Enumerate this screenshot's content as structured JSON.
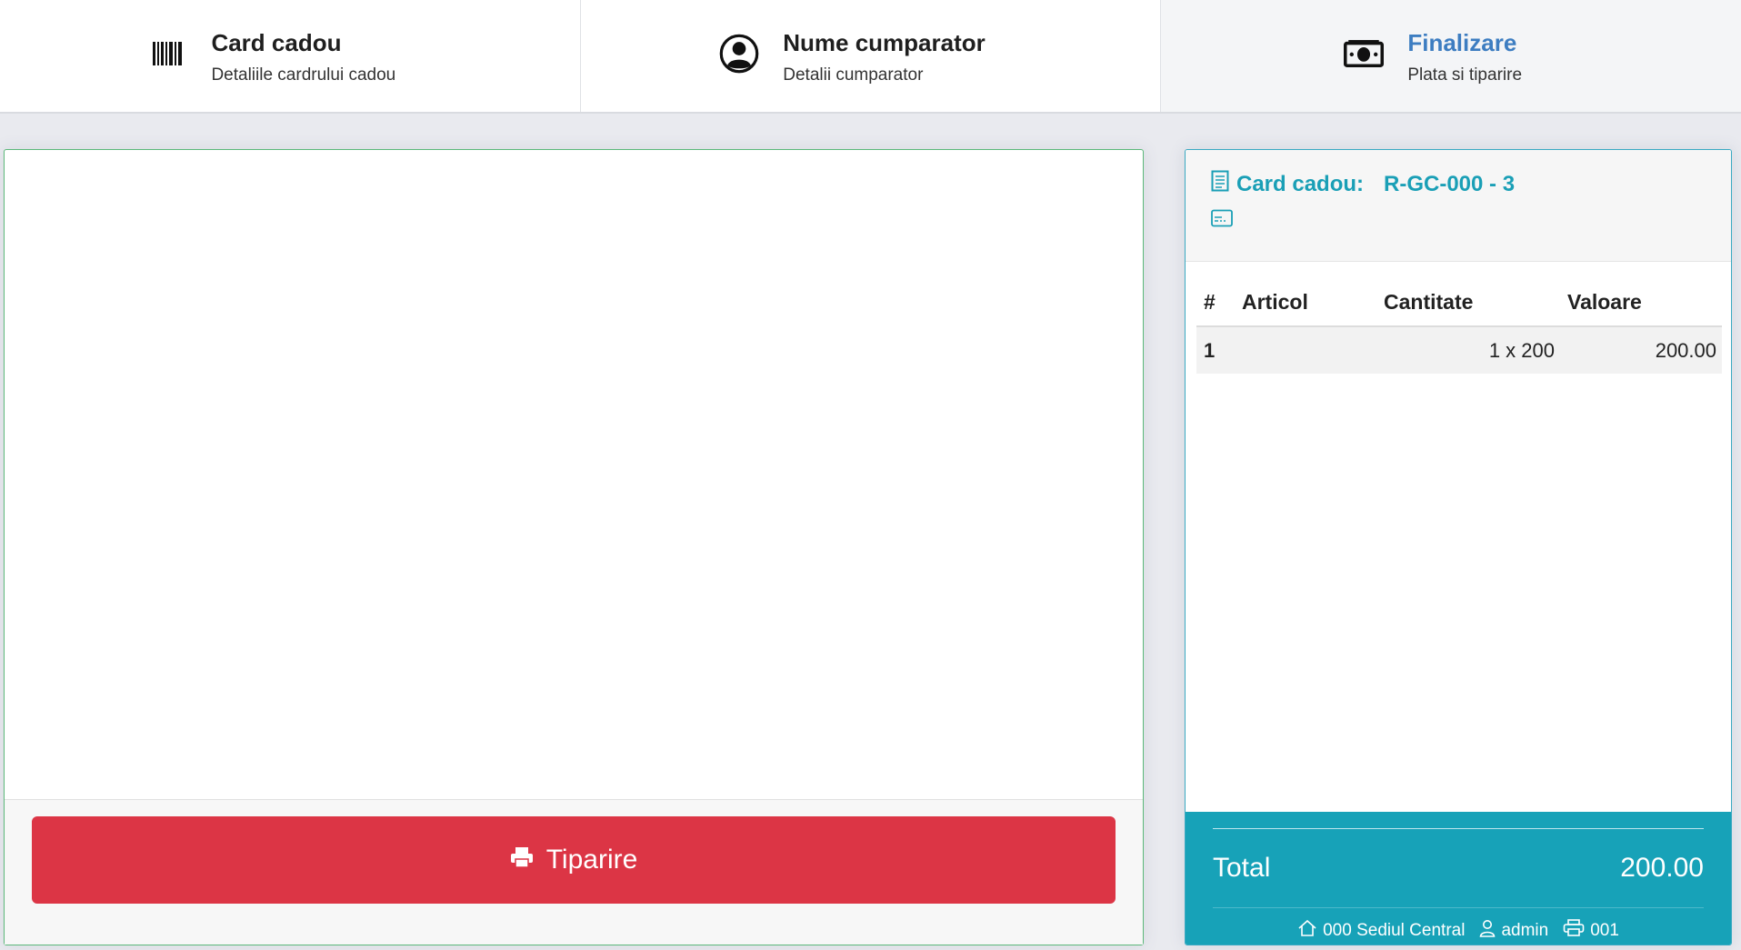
{
  "steps": [
    {
      "title": "Card cadou",
      "subtitle": "Detaliile cardrului cadou",
      "icon": "barcode-icon",
      "active": false
    },
    {
      "title": "Nume cumparator",
      "subtitle": "Detalii cumparator",
      "icon": "user-circle-icon",
      "active": false
    },
    {
      "title": "Finalizare",
      "subtitle": "Plata si tiparire",
      "icon": "money-icon",
      "active": true
    }
  ],
  "actions": {
    "print_label": "Tiparire"
  },
  "receipt": {
    "title_label": "Card cadou:",
    "code": "R-GC-000 - 3",
    "columns": {
      "index": "#",
      "item": "Articol",
      "quantity": "Cantitate",
      "value": "Valoare"
    },
    "rows": [
      {
        "index": "1",
        "item": "",
        "quantity": "1 x 200",
        "value": "200.00"
      }
    ],
    "total_label": "Total",
    "total_value": "200.00",
    "location": "000 Sediul Central",
    "user": "admin",
    "printer": "001"
  },
  "colors": {
    "accent": "#17a2b8",
    "danger": "#dc3545",
    "active_step": "#3d7dc1",
    "success_border": "#5cb87a"
  }
}
